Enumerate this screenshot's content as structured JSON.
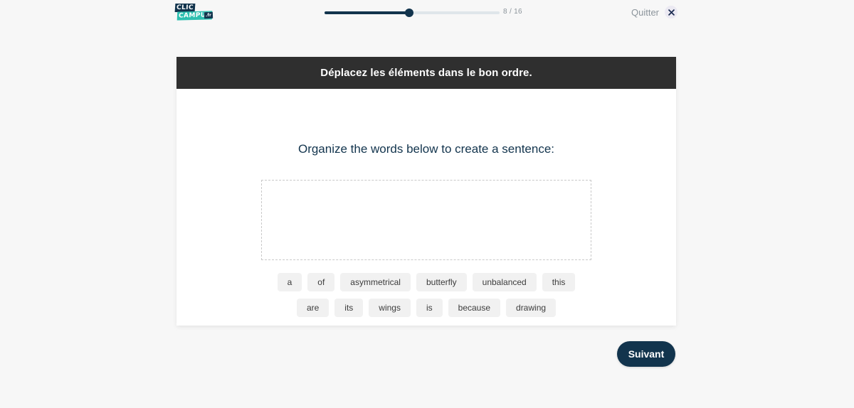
{
  "brand": {
    "name_part1": "CLIC",
    "name_part2": "CAMPUS",
    "tld": ".fr",
    "navy": "#12344d",
    "teal": "#2dbfb0"
  },
  "topbar": {
    "progress": {
      "current": 8,
      "total": 16,
      "label": "8 / 16",
      "percent": 50
    },
    "quit": {
      "label": "Quitter",
      "close_icon": "close-icon"
    }
  },
  "card": {
    "header_title": "Déplacez les éléments dans le bon ordre.",
    "prompt": "Organize the words below to create a sentence:",
    "dropzone_placeholder": "",
    "word_rows": [
      [
        "a",
        "of",
        "asymmetrical",
        "butterfly",
        "unbalanced",
        "this"
      ],
      [
        "are",
        "its",
        "wings",
        "is",
        "because",
        "drawing"
      ]
    ]
  },
  "footer": {
    "next_label": "Suivant"
  }
}
